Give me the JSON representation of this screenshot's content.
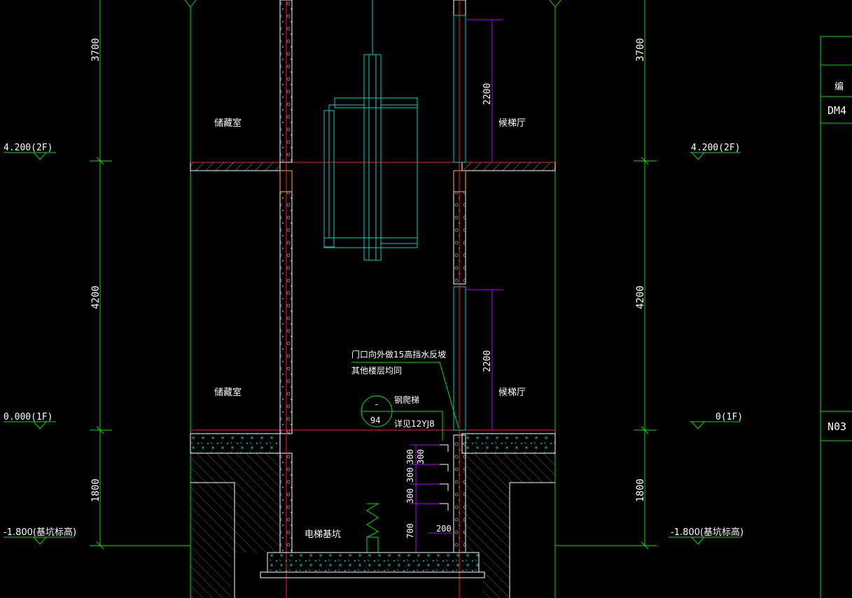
{
  "colors": {
    "background": "#000000",
    "green": "#00e000",
    "white": "#ffffff",
    "red": "#ff2020",
    "cyan": "#00d0c0",
    "magenta": "#b000ff",
    "orange": "#ffb040",
    "gray": "#a0a0a0"
  },
  "dims": {
    "left": {
      "d3700": "3700",
      "d4200": "4200",
      "d1800": "1800"
    },
    "right": {
      "d3700": "3700",
      "d4200": "4200",
      "d1800": "1800"
    },
    "door_upper": "2200",
    "door_lower": "2200",
    "ladder_300a": "300",
    "ladder_300b": "300",
    "ladder_300c": "300",
    "ladder_300d": "300",
    "ladder_700": "700",
    "ladder_200": "200"
  },
  "levels": {
    "left_2f": "4.200(2F)",
    "right_2f": "4.200(2F)",
    "left_1f": "0.000(1F)",
    "right_1f": "0(1F)",
    "left_pit": "-1.800(基坑标高)",
    "right_pit": "-1.800(基坑标高)"
  },
  "rooms": {
    "storage_upper": "储藏室",
    "storage_lower": "储藏室",
    "hall_upper": "候梯厅",
    "hall_lower": "候梯厅",
    "pit": "电梯基坑"
  },
  "notes": {
    "note_line1": "门口向外做15高挡水反坡",
    "note_line2": "其他楼层均同",
    "ladder_label": "钢爬梯",
    "ladder_ref": "详见12YJ8",
    "detail_top": "-",
    "detail_bottom": "94"
  },
  "title_block": {
    "header": "编",
    "code": "DM4",
    "number": "N03"
  }
}
